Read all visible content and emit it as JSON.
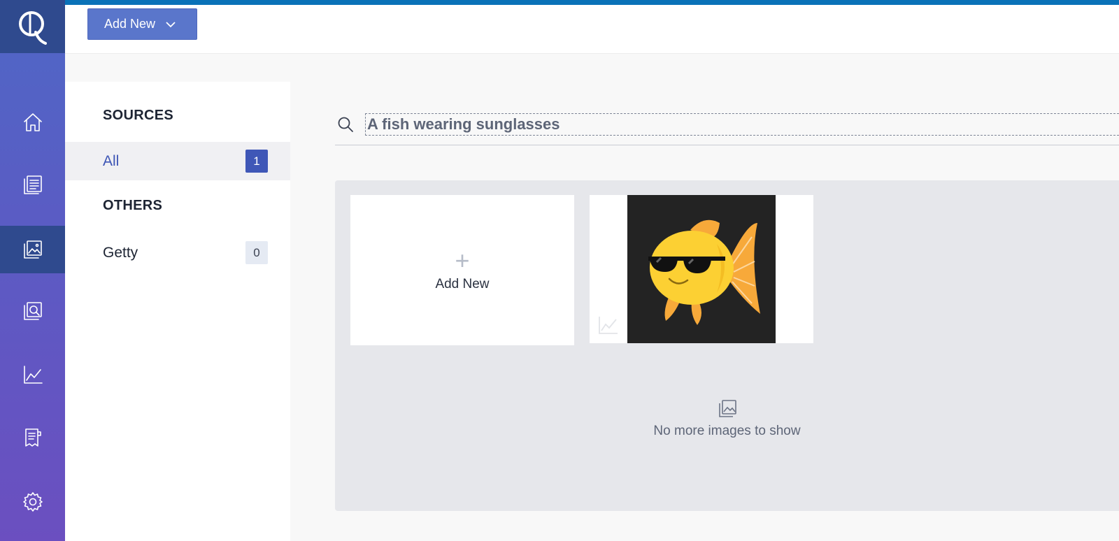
{
  "header": {
    "add_new_label": "Add New"
  },
  "rail": {
    "items": [
      {
        "name": "home",
        "active": false
      },
      {
        "name": "stories",
        "active": false
      },
      {
        "name": "media",
        "active": true
      },
      {
        "name": "media-review",
        "active": false
      },
      {
        "name": "analytics",
        "active": false
      },
      {
        "name": "reports",
        "active": false
      },
      {
        "name": "settings",
        "active": false
      }
    ]
  },
  "sources": {
    "heading": "SOURCES",
    "all_label": "All",
    "all_count": "1",
    "others_heading": "OTHERS",
    "getty_label": "Getty",
    "getty_count": "0"
  },
  "search": {
    "value": "A fish wearing sunglasses"
  },
  "gallery": {
    "add_new_label": "Add New",
    "add_new_icon": "+",
    "empty_message": "No more images to show"
  },
  "colors": {
    "accent": "#0a72b8",
    "brand": "#3f57b7",
    "rail_active": "#2f4a8e"
  }
}
